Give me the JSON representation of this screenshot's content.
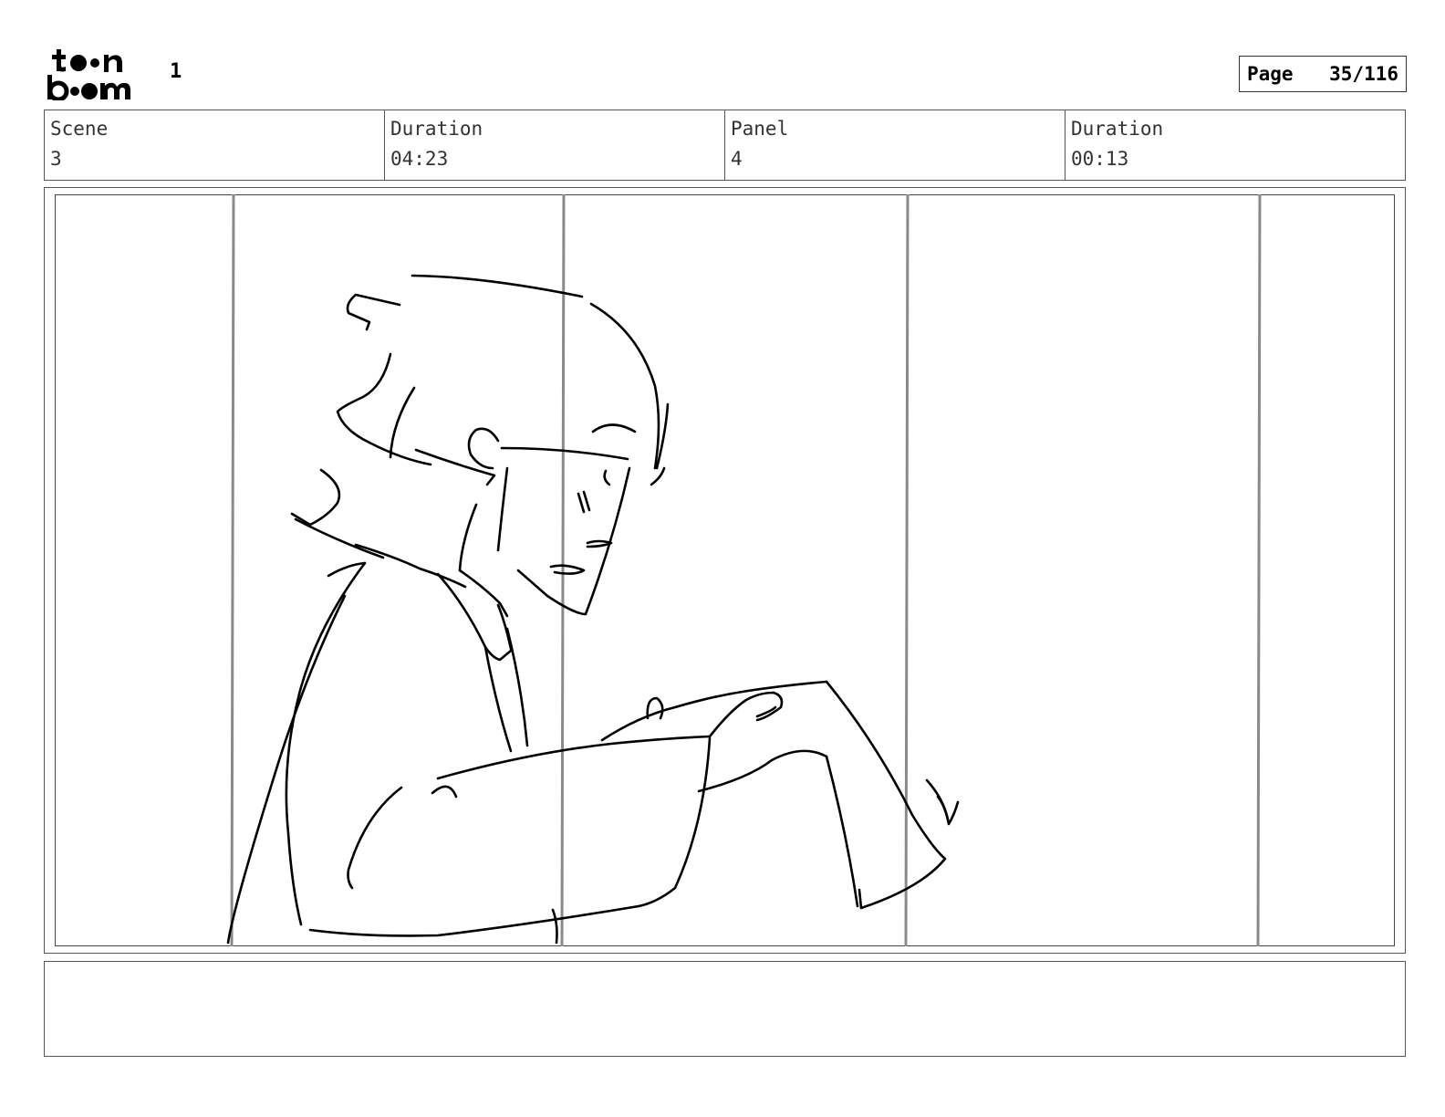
{
  "header": {
    "logo_text": "toon boom",
    "sheet_number": "1",
    "page_label": "Page",
    "page_value": "35/116"
  },
  "fields": {
    "scene_label": "Scene",
    "scene_value": "3",
    "scene_duration_label": "Duration",
    "scene_duration_value": "04:23",
    "panel_label": "Panel",
    "panel_value": "4",
    "panel_duration_label": "Duration",
    "panel_duration_value": "00:13"
  },
  "colors": {
    "ink": "#000000",
    "guide": "#8a8a8a",
    "border": "#555555"
  }
}
